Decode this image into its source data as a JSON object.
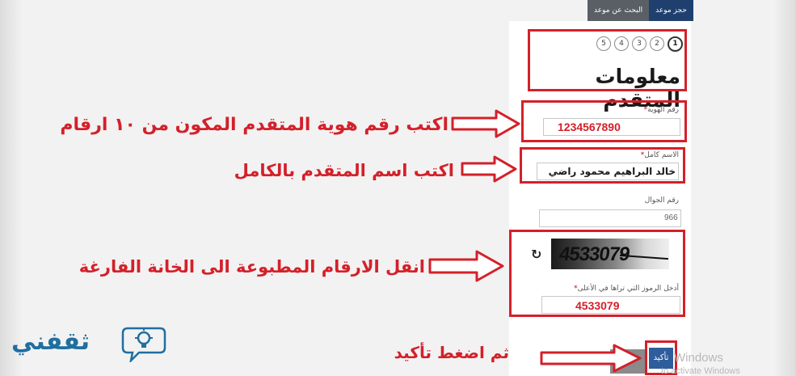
{
  "nav": {
    "tabs": [
      {
        "label": "حجز موعد"
      },
      {
        "label": "البحث عن موعد"
      }
    ]
  },
  "steps": [
    "1",
    "2",
    "3",
    "4",
    "5"
  ],
  "section_title": "معلومات المتقدم",
  "fields": {
    "id_number": {
      "label": "رقم الهوية",
      "value": "1234567890"
    },
    "full_name": {
      "label": "الاسم كامل",
      "value": "خالد البراهيم محمود راضي"
    },
    "mobile": {
      "label": "رقم الجوال",
      "value": "966"
    },
    "captcha": {
      "image_text": "4533079",
      "label": "أدخل الرموز التي تراها في الأعلى",
      "value": "4533079"
    }
  },
  "buttons": {
    "confirm": "تأكيد"
  },
  "annotations": {
    "id_hint": "اكتب رقم هوية المتقدم المكون من ١٠ ارقام",
    "name_hint": "اكتب اسم المتقدم بالكامل",
    "captcha_hint": "انقل الارقام المطبوعة الى الخانة الفارغة",
    "confirm_hint": "ثم اضغط تأكيد"
  },
  "watermark": {
    "line1": "Windows",
    "line2": "to activate Windows"
  },
  "logo": {
    "text": "ثقفني"
  },
  "colors": {
    "annotation_red": "#d4202a",
    "nav_blue": "#1f3f6e",
    "button_blue": "#2e5d9b",
    "logo_blue": "#1f6fa0"
  }
}
